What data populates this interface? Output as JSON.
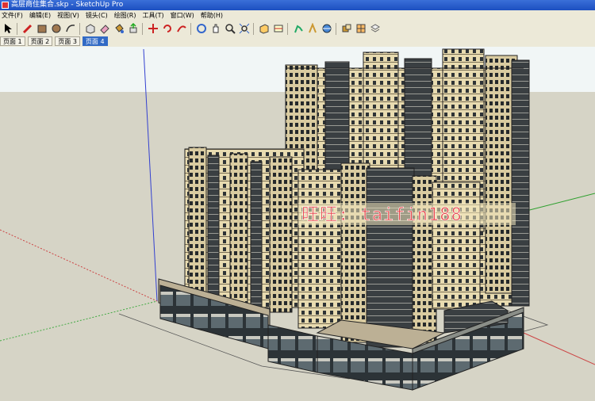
{
  "window": {
    "title": "高层商住集合.skp - SketchUp Pro"
  },
  "menu": [
    "文件(F)",
    "编辑(E)",
    "视图(V)",
    "镜头(C)",
    "绘图(R)",
    "工具(T)",
    "窗口(W)",
    "帮助(H)"
  ],
  "toolbar_icons": [
    "select-arrow-icon",
    "pencil-icon",
    "rectangle-icon",
    "circle-icon",
    "arc-icon",
    "make-component-icon",
    "eraser-icon",
    "paint-bucket-icon",
    "push-pull-icon",
    "move-icon",
    "rotate-icon",
    "follow-me-icon",
    "orbit-icon",
    "pan-icon",
    "zoom-icon",
    "zoom-extents-icon",
    "top-view-icon",
    "section-icon",
    "walk-icon",
    "look-around-icon",
    "components-icon",
    "materials-icon"
  ],
  "page_tabs": [
    {
      "label": "页面 1",
      "active": false
    },
    {
      "label": "页面 2",
      "active": false
    },
    {
      "label": "页面 3",
      "active": false
    },
    {
      "label": "页面 4",
      "active": true
    }
  ],
  "watermark": "旺旺: taifin188",
  "colors": {
    "sky": "#f1f6f6",
    "ground": "#d6d4c6",
    "facade": "#e8dbb0",
    "glass": "#3a3f42",
    "watermark": "#e8474a"
  }
}
